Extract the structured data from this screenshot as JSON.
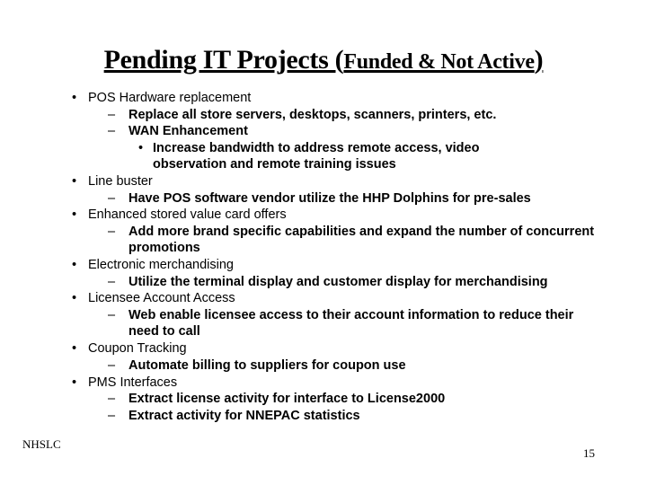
{
  "slide": {
    "title_main": "Pending IT Projects (",
    "title_small": "Funded & Not Active",
    "title_close": ")",
    "items": [
      {
        "bullet": "•",
        "text": "POS Hardware replacement",
        "children": [
          {
            "bullet": "–",
            "text": "Replace all store servers, desktops, scanners, printers, etc."
          },
          {
            "bullet": "–",
            "text": "WAN Enhancement",
            "children": [
              {
                "bullet": "•",
                "text": "Increase bandwidth to address remote access, video observation and remote training issues"
              }
            ]
          }
        ]
      },
      {
        "bullet": "•",
        "text": "Line buster",
        "children": [
          {
            "bullet": "–",
            "text": "Have POS software vendor utilize the HHP Dolphins for pre-sales"
          }
        ]
      },
      {
        "bullet": "•",
        "text": "Enhanced stored value card offers",
        "children": [
          {
            "bullet": "–",
            "text": "Add more brand specific capabilities and expand the number of concurrent promotions"
          }
        ]
      },
      {
        "bullet": "•",
        "text": "Electronic merchandising",
        "children": [
          {
            "bullet": "–",
            "text": "Utilize the terminal display and customer display for merchandising"
          }
        ]
      },
      {
        "bullet": "•",
        "text": "Licensee Account Access",
        "children": [
          {
            "bullet": "–",
            "text": "Web enable licensee access to their account information to reduce their need to call"
          }
        ]
      },
      {
        "bullet": "•",
        "text": "Coupon Tracking",
        "children": [
          {
            "bullet": "–",
            "text": "Automate billing to suppliers for coupon use"
          }
        ]
      },
      {
        "bullet": "•",
        "text": "PMS Interfaces",
        "children": [
          {
            "bullet": "–",
            "text": "Extract license activity for interface to License2000"
          },
          {
            "bullet": "–",
            "text": "Extract activity for NNEPAC statistics"
          }
        ]
      }
    ],
    "footer_left": "NHSLC",
    "page_number": "15"
  }
}
